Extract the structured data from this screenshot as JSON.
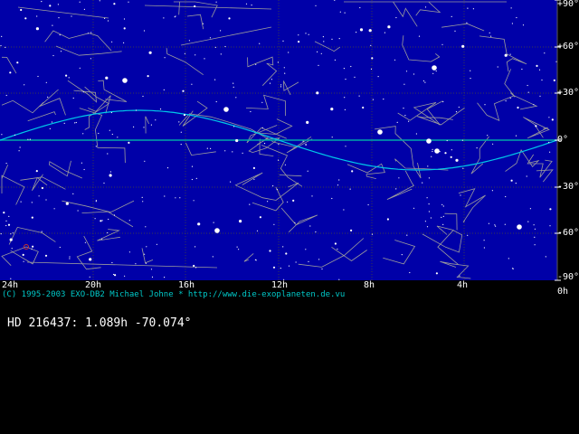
{
  "map": {
    "ra_labels": [
      "24h",
      "20h",
      "16h",
      "12h",
      "8h",
      "4h",
      "0h"
    ],
    "dec_labels": [
      "+90°",
      "+60°",
      "+30°",
      "0°",
      "-30°",
      "-60°",
      "-90°"
    ],
    "colors": {
      "sky": "#0000a8",
      "grid": "#3a3a3a",
      "constellation_lines": "#a8a8a8",
      "equator": "#00a8a8",
      "ecliptic": "#00c8e8",
      "stars": "#ffffff",
      "selected_marker": "#c83232"
    }
  },
  "footer": {
    "credit": "(C) 1995-2003 EXO-DB2 Michael Johne * http://www.die-exoplaneten.de.vu"
  },
  "selection": {
    "readout": "HD 216437: 1.089h -70.074°"
  }
}
